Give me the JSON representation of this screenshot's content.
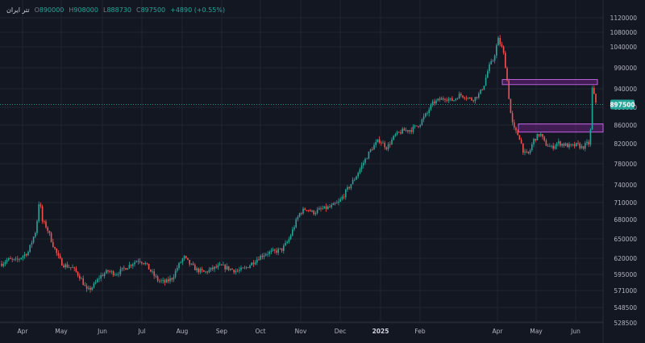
{
  "legend": {
    "symbol": "تتر ایران",
    "o_key": "O",
    "o_val": "890000",
    "h_key": "H",
    "h_val": "908000",
    "l_key": "L",
    "l_val": "888730",
    "c_key": "C",
    "c_val": "897500",
    "change": "+4890 (+0.55%)"
  },
  "colors": {
    "background": "#131722",
    "grid": "#1f2433",
    "up": "#26a69a",
    "down": "#ef5350",
    "axis_text": "#b2b5be",
    "zone_fill": "#9c27b0",
    "zone_stroke": "#c060e0",
    "price_badge": "#26a69a"
  },
  "chart_data": {
    "type": "candlestick",
    "y_ticks": [
      "1120000",
      "1080000",
      "1040000",
      "990000",
      "940000",
      "890000",
      "860000",
      "820000",
      "780000",
      "740000",
      "710000",
      "680000",
      "650000",
      "620000",
      "595000",
      "571000",
      "548500",
      "528500"
    ],
    "x_ticks": [
      "Apr",
      "May",
      "Jun",
      "Jul",
      "Aug",
      "Sep",
      "Oct",
      "Nov",
      "Dec",
      "2025",
      "Feb",
      "Apr",
      "May",
      "Jun"
    ],
    "last_price": 897500,
    "last_price_label": "897500",
    "zones": [
      {
        "top": 962000,
        "bottom": 950000,
        "from": "Apr",
        "to": "last"
      },
      {
        "top": 862000,
        "bottom": 845000,
        "from": "Apr",
        "to": "end"
      }
    ],
    "path": [
      [
        0,
        610000
      ],
      [
        10,
        618000
      ],
      [
        20,
        616000
      ],
      [
        35,
        630000
      ],
      [
        45,
        665000
      ],
      [
        49,
        720000
      ],
      [
        52,
        678000
      ],
      [
        58,
        668000
      ],
      [
        66,
        640000
      ],
      [
        72,
        622000
      ],
      [
        78,
        610000
      ],
      [
        90,
        605000
      ],
      [
        100,
        590000
      ],
      [
        108,
        570000
      ],
      [
        116,
        578000
      ],
      [
        124,
        592000
      ],
      [
        134,
        600000
      ],
      [
        144,
        596000
      ],
      [
        154,
        604000
      ],
      [
        164,
        612000
      ],
      [
        172,
        618000
      ],
      [
        180,
        612000
      ],
      [
        188,
        598000
      ],
      [
        196,
        586000
      ],
      [
        205,
        583000
      ],
      [
        214,
        590000
      ],
      [
        220,
        606000
      ],
      [
        228,
        622000
      ],
      [
        236,
        610000
      ],
      [
        244,
        602000
      ],
      [
        254,
        598000
      ],
      [
        264,
        604000
      ],
      [
        274,
        608000
      ],
      [
        284,
        604000
      ],
      [
        294,
        600000
      ],
      [
        304,
        604000
      ],
      [
        314,
        614000
      ],
      [
        322,
        622000
      ],
      [
        330,
        628000
      ],
      [
        340,
        630000
      ],
      [
        350,
        634000
      ],
      [
        358,
        648000
      ],
      [
        365,
        670000
      ],
      [
        372,
        692000
      ],
      [
        380,
        700000
      ],
      [
        388,
        692000
      ],
      [
        398,
        698000
      ],
      [
        410,
        702000
      ],
      [
        420,
        710000
      ],
      [
        430,
        730000
      ],
      [
        440,
        752000
      ],
      [
        450,
        780000
      ],
      [
        460,
        808000
      ],
      [
        470,
        828000
      ],
      [
        480,
        812000
      ],
      [
        490,
        838000
      ],
      [
        500,
        848000
      ],
      [
        510,
        850000
      ],
      [
        520,
        862000
      ],
      [
        530,
        880000
      ],
      [
        536,
        900000
      ],
      [
        544,
        910000
      ],
      [
        552,
        915000
      ],
      [
        562,
        908000
      ],
      [
        570,
        924000
      ],
      [
        578,
        918000
      ],
      [
        586,
        910000
      ],
      [
        594,
        925000
      ],
      [
        600,
        948000
      ],
      [
        606,
        990000
      ],
      [
        612,
        1010000
      ],
      [
        618,
        1060000
      ],
      [
        624,
        1030000
      ],
      [
        628,
        980000
      ],
      [
        631,
        920000
      ],
      [
        634,
        870000
      ],
      [
        638,
        850000
      ],
      [
        644,
        835000
      ],
      [
        650,
        800000
      ],
      [
        656,
        800000
      ],
      [
        662,
        828000
      ],
      [
        670,
        842000
      ],
      [
        676,
        820000
      ],
      [
        684,
        812000
      ],
      [
        692,
        822000
      ],
      [
        700,
        818000
      ],
      [
        708,
        814000
      ],
      [
        716,
        818000
      ],
      [
        722,
        812000
      ],
      [
        728,
        820000
      ],
      [
        731,
        820000
      ],
      [
        733,
        860000
      ],
      [
        735,
        960000
      ],
      [
        737,
        918000
      ],
      [
        740,
        897500
      ]
    ]
  }
}
